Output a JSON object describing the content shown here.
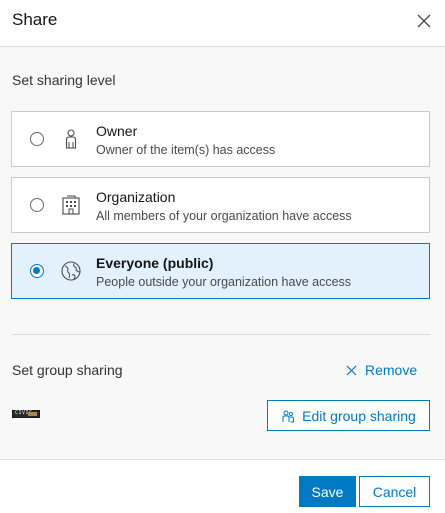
{
  "dialog": {
    "title": "Share",
    "close_icon": "close-icon"
  },
  "sharing_level": {
    "label": "Set sharing level",
    "selected": "everyone",
    "options": [
      {
        "id": "owner",
        "title": "Owner",
        "description": "Owner of the item(s) has access",
        "icon": "user-icon",
        "selected": false
      },
      {
        "id": "organization",
        "title": "Organization",
        "description": "All members of your organization have access",
        "icon": "organization-icon",
        "selected": false
      },
      {
        "id": "everyone",
        "title": "Everyone (public)",
        "description": "People outside your organization have access",
        "icon": "globe-icon",
        "selected": true
      }
    ]
  },
  "group_sharing": {
    "label": "Set group sharing",
    "remove_label": "Remove",
    "edit_label": "Edit group sharing",
    "thumbnail_text": "CIVIC",
    "remove_icon": "x-icon",
    "edit_icon": "group-icon"
  },
  "footer": {
    "save_label": "Save",
    "cancel_label": "Cancel"
  },
  "colors": {
    "accent": "#007ac2",
    "selected_background": "#e2f1fb",
    "border": "#cacaca"
  }
}
